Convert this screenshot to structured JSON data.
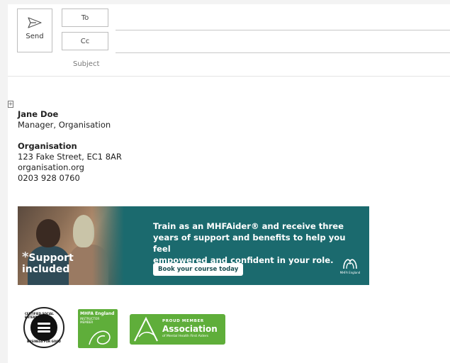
{
  "compose": {
    "send_label": "Send",
    "to_label": "To",
    "cc_label": "Cc",
    "subject_label": "Subject"
  },
  "signature": {
    "name": "Jane Doe",
    "title": "Manager, Organisation",
    "org_name": "Organisation",
    "address": "123 Fake Street, EC1 8AR",
    "website": "organisation.org",
    "phone": "0203 928 0760"
  },
  "banner": {
    "support_star": "*",
    "support_line1": "Support",
    "support_line2": "included",
    "message_line1": "Train as an MHFAider® and receive three",
    "message_line2": "years of support and benefits to help you feel",
    "message_line3": "empowered and confident in your role.",
    "cta_label": "Book your course today",
    "logo_text": "MHFA England",
    "colors": {
      "background": "#1b6a6e",
      "cta_text": "#1b4f52"
    }
  },
  "badges": {
    "social_enterprise_ring_top": "CERTIFIED SOCIAL ENTERPRISE",
    "social_enterprise_ring_bottom": "BUSINESS FOR GOOD",
    "instructor_title": "MHFA England",
    "instructor_line1": "INSTRUCTOR",
    "instructor_line2": "MEMBER",
    "assoc_line1": "PROUD MEMBER",
    "assoc_line2": "Association",
    "assoc_line3": "of Mental Health First Aiders",
    "colors": {
      "green": "#5fae3a"
    }
  }
}
